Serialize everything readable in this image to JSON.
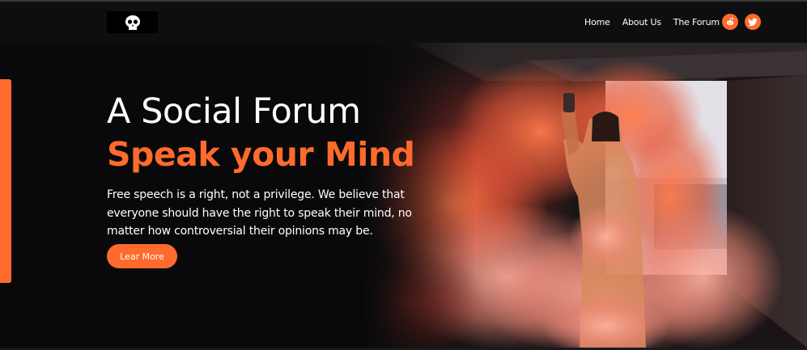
{
  "nav": {
    "links": [
      "Home",
      "About Us",
      "The Forum"
    ],
    "social": [
      "reddit-icon",
      "twitter-icon"
    ]
  },
  "hero": {
    "title": "A Social Forum",
    "subtitle": "Speak your Mind",
    "description": "Free speech is a right, not a privilege. We believe that everyone should have the right to speak their mind, no matter how controversial their opinions may be.",
    "cta_label": "Lear More"
  },
  "colors": {
    "accent": "#ff6b2c",
    "background": "#09090b",
    "navbar": "#0e0e10"
  }
}
